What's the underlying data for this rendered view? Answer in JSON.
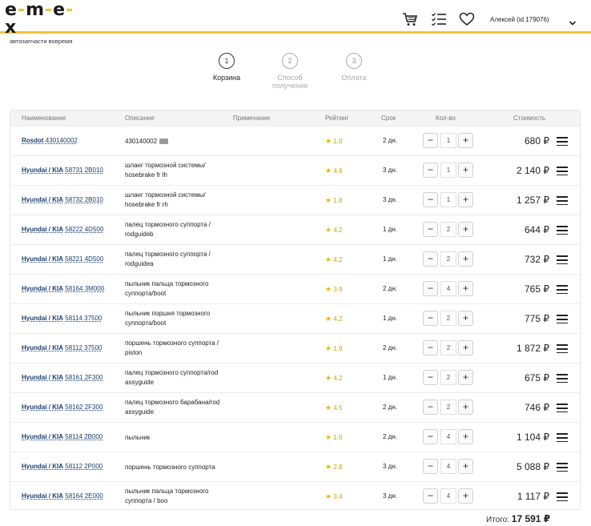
{
  "header": {
    "logo_text": "e-m-e-x",
    "logo_tagline": "автозапчасти вовремя",
    "user_label": "Алексей  (id 179076)"
  },
  "steps": [
    {
      "num": "1",
      "label": "Корзина",
      "active": true
    },
    {
      "num": "2",
      "label": "Способ получения",
      "active": false
    },
    {
      "num": "3",
      "label": "Оплата",
      "active": false
    }
  ],
  "table": {
    "columns": {
      "name": "Наименование",
      "description": "Описание",
      "note": "Примечание",
      "rating": "Рейтинг",
      "term": "Срок",
      "qty": "Кол-во",
      "cost": "Стоимость"
    },
    "rows": [
      {
        "brand": "Rosdot",
        "part": "430140002",
        "desc1": "430140002",
        "desc2": "",
        "rating": "1.0",
        "term": "2 дн.",
        "qty": "1",
        "price": "680 ₽",
        "badge": true
      },
      {
        "brand": "Hyundai / KIA",
        "part": "58731 2B010",
        "desc1": "шланг тормозной системы/",
        "desc2": "hosebrake fr lh",
        "rating": "4.6",
        "term": "3 дн.",
        "qty": "1",
        "price": "2 140 ₽"
      },
      {
        "brand": "Hyundai / KIA",
        "part": "58732 2B010",
        "desc1": "шланг тормозной системы/",
        "desc2": "hosebrake fr rh",
        "rating": "1.8",
        "term": "3 дн.",
        "qty": "1",
        "price": "1 257 ₽"
      },
      {
        "brand": "Hyundai / KIA",
        "part": "58222 4D500",
        "desc1": "палец тормозного суппорта /",
        "desc2": "rodguideb",
        "rating": "4.2",
        "term": "1 дн.",
        "qty": "2",
        "price": "644 ₽"
      },
      {
        "brand": "Hyundai / KIA",
        "part": "58221 4D500",
        "desc1": "палец тормозного суппорта /",
        "desc2": "rodguidea",
        "rating": "4.2",
        "term": "1 дн.",
        "qty": "2",
        "price": "732 ₽"
      },
      {
        "brand": "Hyundai / KIA",
        "part": "58164 3M000",
        "desc1": "пыльник пальца тормозного",
        "desc2": "суппорта/boot",
        "rating": "3.9",
        "term": "2 дн.",
        "qty": "4",
        "price": "765 ₽"
      },
      {
        "brand": "Hyundai / KIA",
        "part": "58114 37500",
        "desc1": "пыльник поршня тормозного",
        "desc2": "суппорта/boot",
        "rating": "4.2",
        "term": "1 дн.",
        "qty": "2",
        "price": "775 ₽"
      },
      {
        "brand": "Hyundai / KIA",
        "part": "58112 37500",
        "desc1": "поршень тормозного суппорта /",
        "desc2": "piston",
        "rating": "1.9",
        "term": "2 дн.",
        "qty": "2",
        "price": "1 872 ₽"
      },
      {
        "brand": "Hyundai / KIA",
        "part": "58161 2F300",
        "desc1": "палец тормозного суппорта/rod",
        "desc2": "assyguide",
        "rating": "4.2",
        "term": "1 дн.",
        "qty": "2",
        "price": "675 ₽"
      },
      {
        "brand": "Hyundai / KIA",
        "part": "58162 2F300",
        "desc1": "палец тормозного барабана/rod",
        "desc2": "assyguide",
        "rating": "4.5",
        "term": "2 дн.",
        "qty": "2",
        "price": "746 ₽"
      },
      {
        "brand": "Hyundai / KIA",
        "part": "58114 2B000",
        "desc1": "пыльник",
        "desc2": "",
        "rating": "1.0",
        "term": "2 дн.",
        "qty": "4",
        "price": "1 104 ₽"
      },
      {
        "brand": "Hyundai / KIA",
        "part": "58112 2P000",
        "desc1": "поршень тормозного суппорта",
        "desc2": "",
        "rating": "2.8",
        "term": "3 дн.",
        "qty": "4",
        "price": "5 088 ₽"
      },
      {
        "brand": "Hyundai / KIA",
        "part": "58164 2E000",
        "desc1": "пыльник пальца тормозного",
        "desc2": "суппорта / boo",
        "rating": "3.4",
        "term": "3 дн.",
        "qty": "4",
        "price": "1 117 ₽"
      }
    ]
  },
  "summary": {
    "total_label": "Итого:",
    "total_value": "17 591 ₽"
  },
  "colors": {
    "accent": "#f0c33c",
    "link": "#1a3e6e",
    "star": "#f0b400"
  }
}
